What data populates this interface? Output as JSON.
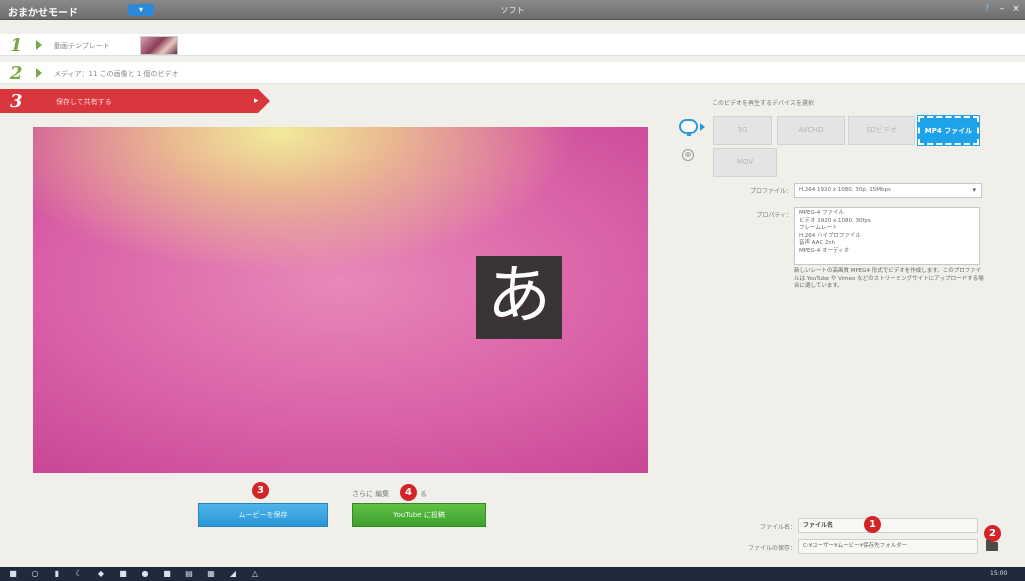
{
  "titlebar": {
    "mode_label": "おまかせモード",
    "mode_button": "▾",
    "app_title": "ソフト",
    "help": "?",
    "minimize": "–",
    "close": "×"
  },
  "steps": {
    "step1": {
      "num": "1",
      "label": "動画テンプレート"
    },
    "step2": {
      "num": "2",
      "label": "メディア：11 この画像と 1 個のビデオ"
    },
    "step3": {
      "num": "3",
      "label": "保存して共有する",
      "chevron": "▸"
    }
  },
  "preview": {
    "glyph": "あ"
  },
  "bottom": {
    "badge3": "3",
    "badge4": "4",
    "more_label": "さらに 編集",
    "more_suffix": "る",
    "blue_button": "ムービーを保存",
    "green_button": "YouTube に投稿"
  },
  "panel": {
    "caption": "このビデオを再生するデバイスを選択",
    "formats": [
      "3G",
      "AVCHD",
      "SDビデオ",
      "MP4 ファイル",
      "MOV"
    ],
    "profile_label": "プロファイル：",
    "profile_value": "H.264 1920 x 1080, 30p, 15Mbps",
    "desc_label": "プロパティ：",
    "desc_lines": [
      "MPEG-4 ファイル",
      "ビデオ 1920 x 1080, 30fps",
      "フレームレート",
      "H.264 ハイプロファイル",
      "音声 AAC 2ch",
      "MPEG-4 オーディオ"
    ],
    "desc_note": "新しいレートの高画質 MPEG4 形式でビデオを作成します。このプロファイルは YouTube や Vimeo などのストリーミングサイトにアップロードする場合に適しています。",
    "name_label": "ファイル名：",
    "name_value": "ファイル名",
    "save_label": "ファイルの保存：",
    "save_value": "C:¥ユーザー¥ムービー¥保存先フォルダー",
    "badge1": "1",
    "badge2": "2"
  },
  "taskbar": {
    "items": [
      "■",
      "○",
      "▮",
      "☾",
      "◆",
      "■",
      "●",
      "■",
      "▤",
      "▦",
      "◢",
      "△"
    ],
    "clock": "15:00"
  }
}
